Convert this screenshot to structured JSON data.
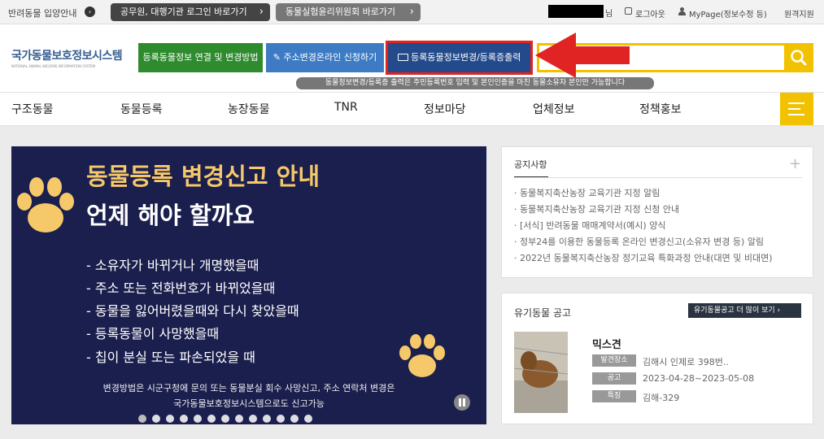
{
  "topbar": {
    "adoption_label": "반려동물 입양안내",
    "official_login": "공무원, 대행기관 로그인 바로가기",
    "ethics_link": "동물실험윤리위원회 바로가기",
    "user_suffix": "님",
    "logout": "로그아웃",
    "mypage": "MyPage(정보수정 등)",
    "remote": "원격지원"
  },
  "header": {
    "logo_title": "국가동물보호정보시스템",
    "logo_sub": "NATIONAL ANIMAL WELFARE INFORMATION SYSTEM",
    "btn_link": "등록동물정보 연결 및 변경방법",
    "btn_address": "주소변경온라인 신청하기",
    "btn_change": "등록동물정보변경/등록증출력",
    "tooltip": "동물정보변경/등록증 출력은 주민등록번호 입력 및 본인인증을 마친 동물소유자 본인만 가능합니다"
  },
  "nav": [
    "구조동물",
    "동물등록",
    "농장동물",
    "TNR",
    "정보마당",
    "업체정보",
    "정책홍보"
  ],
  "banner": {
    "title": "동물등록 변경신고 안내",
    "subtitle": "언제 해야 할까요",
    "items": [
      "- 소유자가 바뀌거나 개명했을때",
      "- 주소 또는 전화번호가 바뀌었을때",
      "- 동물을 잃어버렸을때와 다시 찾았을때",
      "- 등록동물이 사망했을때",
      "- 칩이 분실 또는 파손되었을 때"
    ],
    "footer1": "변경방법은 시군구청에 문의 또는 동물분실 회수 사망신고, 주소 연락처 변경은",
    "footer2": "국가동물보호정보시스템으로도 신고가능"
  },
  "notice": {
    "title": "공지사항",
    "items": [
      "동물복지축산농장 교육기관 지정 알림",
      "동물복지축산농장 교육기관 지정 신청 안내",
      "[서식] 반려동물 매매계약서(예시) 양식",
      "정부24를 이용한 동물등록 온라인 변경신고(소유자 변경 등) 알림",
      "2022년 동물복지축산농장 정기교육 특화과정 안내(대면 및 비대면)"
    ]
  },
  "lost": {
    "title": "유기동물 공고",
    "more": "유기동물공고 더 많이 보기",
    "name": "믹스견",
    "label_place": "발견장소",
    "place": "김해시 인제로 398번..",
    "label_notice": "공고",
    "notice_period": "2023-04-28~2023-05-08",
    "label_feature": "특징",
    "feature": "김해-329"
  },
  "colors": {
    "accent_yellow": "#f2c200",
    "btn_green": "#2e8b2e",
    "btn_blue": "#3d7cc4",
    "btn_navy": "#234a8a",
    "highlight_red": "#e02424",
    "banner_bg": "#1b1f4e",
    "banner_title": "#f5c86a"
  }
}
